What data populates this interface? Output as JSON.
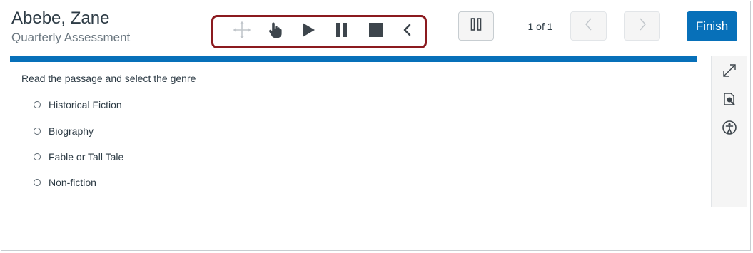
{
  "header": {
    "student_name": "Abebe, Zane",
    "assessment_name": "Quarterly Assessment"
  },
  "tts_toolbar": {
    "tools": [
      "move-icon",
      "pointer-hand-icon",
      "play-icon",
      "pause-icon",
      "stop-icon",
      "collapse-chevron-icon"
    ]
  },
  "navigation": {
    "page_indicator": "1 of 1",
    "finish_label": "Finish"
  },
  "side_tools": [
    "expand-icon",
    "magnifier-icon",
    "accessibility-icon"
  ],
  "question": {
    "prompt": "Read the passage and select the genre",
    "choices": [
      {
        "label": "Historical Fiction"
      },
      {
        "label": "Biography"
      },
      {
        "label": "Fable or Tall Tale"
      },
      {
        "label": "Non-fiction"
      }
    ]
  },
  "colors": {
    "accent": "#0770b9",
    "toolbar_highlight": "#8b1a1f",
    "text": "#2d3b45",
    "muted_text": "#6b7780"
  }
}
